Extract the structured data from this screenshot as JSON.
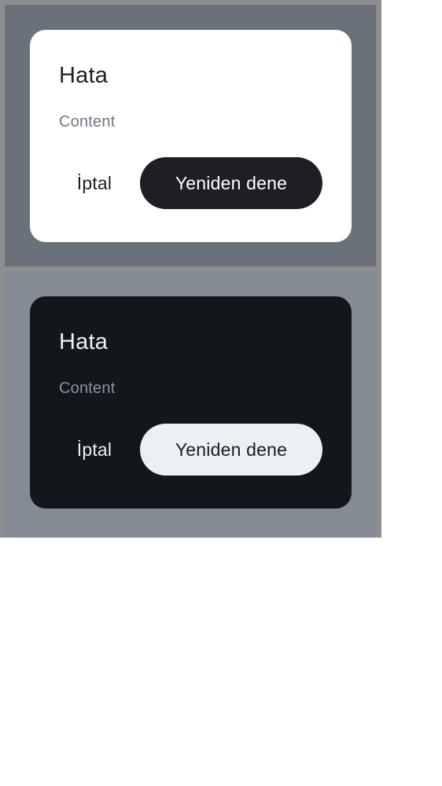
{
  "dialogs": [
    {
      "theme": "light",
      "title": "Hata",
      "content": "Content",
      "cancel_label": "İptal",
      "retry_label": "Yeniden dene",
      "colors": {
        "panel_background": "#6a717b",
        "dialog_background": "#ffffff",
        "primary_button_background": "#1d1f24",
        "primary_button_text": "#ffffff"
      }
    },
    {
      "theme": "dark",
      "title": "Hata",
      "content": "Content",
      "cancel_label": "İptal",
      "retry_label": "Yeniden dene",
      "colors": {
        "panel_background": "#858b95",
        "dialog_background": "#13161b",
        "primary_button_background": "#eceff4",
        "primary_button_text": "#1a1d22"
      }
    }
  ]
}
